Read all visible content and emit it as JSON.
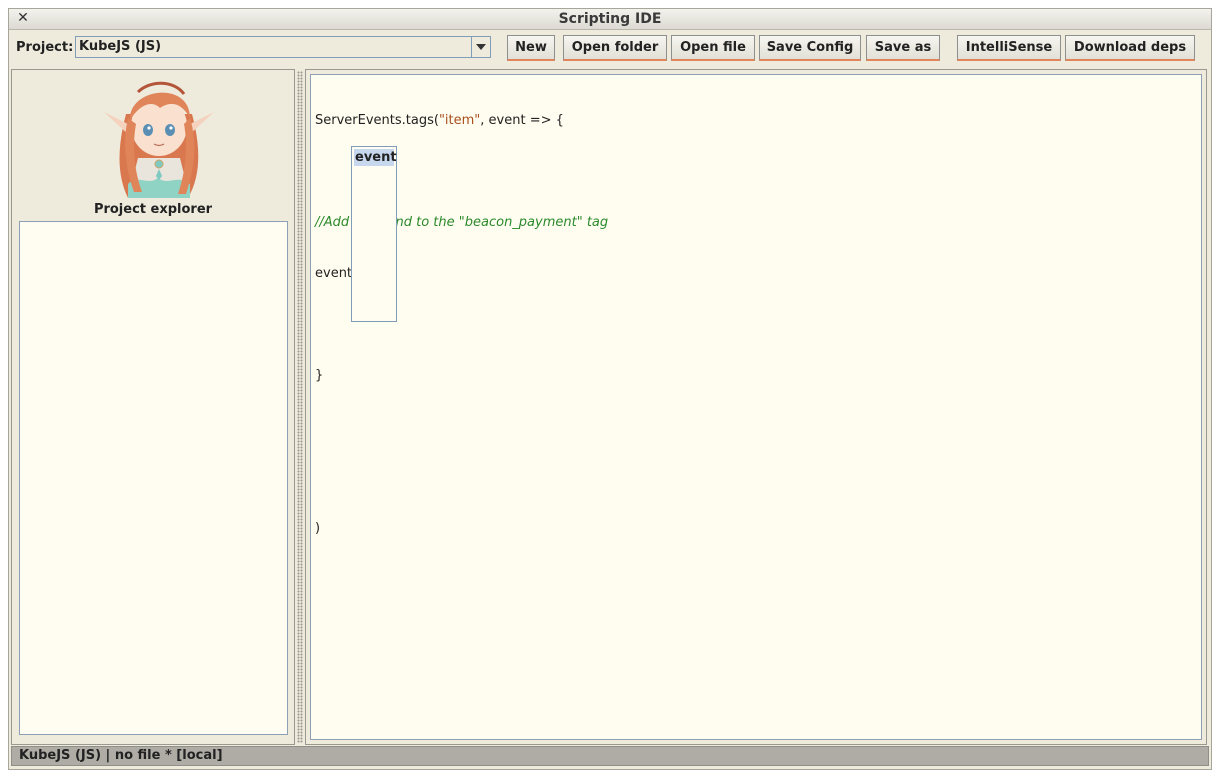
{
  "window": {
    "title": "Scripting IDE",
    "close_icon": "close-icon"
  },
  "toolbar": {
    "project_label": "Project:",
    "project_value": "KubeJS (JS)",
    "buttons": {
      "new": "New",
      "open_folder": "Open folder",
      "open_file": "Open file",
      "save_config": "Save Config",
      "save_as": "Save as",
      "intellisense": "IntelliSense",
      "download_deps": "Download deps"
    }
  },
  "explorer": {
    "label": "Project explorer",
    "avatar": "anime-elf-girl-avatar"
  },
  "editor": {
    "lines": [
      {
        "parts": [
          "ServerEvents.tags(",
          "\"item\"",
          ", event => {"
        ]
      },
      {
        "text": ""
      },
      {
        "comment": "//Add Diamond to the \"beacon_payment\" tag"
      },
      {
        "text": "event"
      },
      {
        "text": ""
      },
      {
        "text": "}"
      },
      {
        "text": ""
      },
      {
        "text": ""
      },
      {
        "text": ")"
      }
    ],
    "autocomplete": [
      "event"
    ]
  },
  "status": {
    "text": "KubeJS (JS) | no file * [local]"
  },
  "colors": {
    "string": "#a8501e",
    "comment": "#2b8a2b",
    "selection": "#c6d7ee",
    "accent": "#e0855c"
  }
}
